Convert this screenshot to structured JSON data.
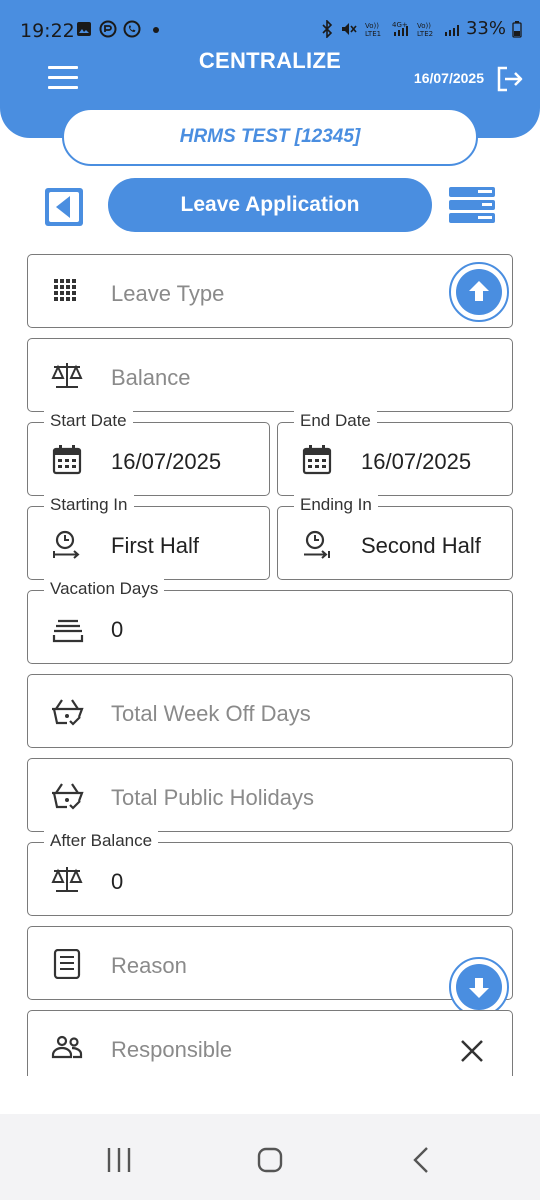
{
  "status_bar": {
    "time": "19:22",
    "battery": "33%",
    "left_icons": [
      "gallery-icon",
      "sync-icon",
      "whatsapp-icon",
      "dot-icon"
    ],
    "right_icons": [
      "bluetooth-icon",
      "mute-icon",
      "volte1-icon",
      "signal-icon",
      "volte2-icon",
      "signal-icon",
      "battery-icon"
    ]
  },
  "header": {
    "app_title": "CENTRALIZE",
    "date": "16/07/2025",
    "background": "#4a8ee0"
  },
  "company": {
    "label": "HRMS TEST [12345]"
  },
  "toolbar": {
    "title": "Leave Application"
  },
  "form": {
    "leave_type": {
      "placeholder": "Leave Type",
      "icon": "grid-icon"
    },
    "balance": {
      "placeholder": "Balance",
      "icon": "scale-icon"
    },
    "start_date": {
      "label": "Start Date",
      "value": "16/07/2025",
      "icon": "calendar-icon"
    },
    "end_date": {
      "label": "End Date",
      "value": "16/07/2025",
      "icon": "calendar-icon"
    },
    "starting_in": {
      "label": "Starting In",
      "value": "First Half",
      "icon": "clock-start-icon"
    },
    "ending_in": {
      "label": "Ending In",
      "value": "Second Half",
      "icon": "clock-end-icon"
    },
    "vacation_days": {
      "label": "Vacation Days",
      "value": "0",
      "icon": "stack-icon"
    },
    "week_off_days": {
      "placeholder": "Total Week Off Days",
      "icon": "basket-check-icon"
    },
    "public_holidays": {
      "placeholder": "Total Public Holidays",
      "icon": "basket-check-icon"
    },
    "after_balance": {
      "label": "After Balance",
      "value": "0",
      "icon": "scale-icon"
    },
    "reason": {
      "placeholder": "Reason",
      "icon": "document-icon"
    },
    "responsible": {
      "placeholder": "Responsible",
      "icon": "people-icon"
    }
  },
  "navbar": {
    "items": [
      "recent-apps-icon",
      "home-icon",
      "back-icon"
    ]
  }
}
